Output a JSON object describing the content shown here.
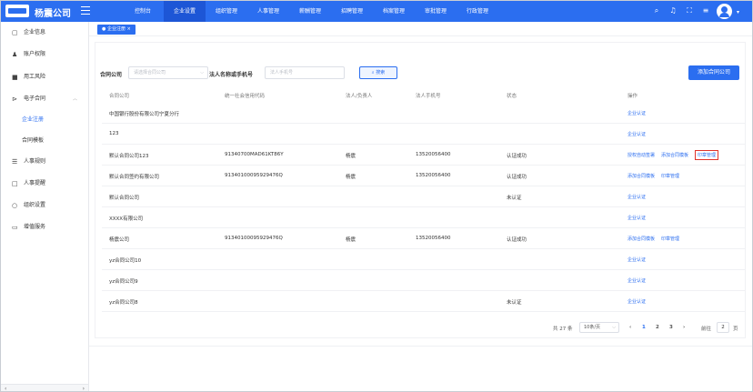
{
  "header": {
    "company": "杨震公司",
    "nav": [
      "控制台",
      "企业设置",
      "组织管理",
      "人事管理",
      "薪酬管理",
      "招聘管理",
      "档案管理",
      "审批管理",
      "行政管理"
    ],
    "active_nav": 1
  },
  "sidebar": {
    "items": [
      {
        "label": "企业信息",
        "icon": "document-icon"
      },
      {
        "label": "账户权限",
        "icon": "user-icon"
      },
      {
        "label": "用工风险",
        "icon": "shield-icon"
      },
      {
        "label": "电子合同",
        "icon": "contract-icon",
        "expanded": true
      }
    ],
    "sub_items": [
      "企业注册",
      "合同模板"
    ],
    "items_after": [
      {
        "label": "人事规则",
        "icon": "list-icon"
      },
      {
        "label": "人事提醒",
        "icon": "bell-icon"
      },
      {
        "label": "组织设置",
        "icon": "org-icon"
      },
      {
        "label": "增值服务",
        "icon": "gift-icon"
      }
    ]
  },
  "tab": {
    "label": "企业注册",
    "close": "×"
  },
  "filters": {
    "company_label": "合同公司",
    "company_placeholder": "请选择合同公司",
    "legal_label": "法人名称或手机号",
    "legal_placeholder": "法人手机号",
    "search_label": "搜索",
    "add_label": "添加合同公司"
  },
  "table": {
    "headers": [
      "合同公司",
      "统一社会信用代码",
      "法人/负责人",
      "法人手机号",
      "状态",
      "操作"
    ],
    "rows": [
      {
        "company": "中国银行股份有限公司宁夏分行",
        "code": "",
        "person": "",
        "phone": "",
        "status": "",
        "ops": [
          "企业认证"
        ]
      },
      {
        "company": "123",
        "code": "",
        "person": "",
        "phone": "",
        "status": "",
        "ops": [
          "企业认证"
        ]
      },
      {
        "company": "默认合同公司123",
        "code": "91340700MAD61KT86Y",
        "person": "杨震",
        "phone": "13520056400",
        "status": "认证成功",
        "ops": [
          "授权自动签署",
          "添加合同模板",
          "印章管理"
        ],
        "highlight": 2
      },
      {
        "company": "默认合同签约有限公司",
        "code": "91340100095929476Q",
        "person": "杨震",
        "phone": "13520056400",
        "status": "认证成功",
        "ops": [
          "添加合同模板",
          "印章管理"
        ]
      },
      {
        "company": "默认合同公司",
        "code": "",
        "person": "",
        "phone": "",
        "status": "未认证",
        "ops": [
          "企业认证"
        ]
      },
      {
        "company": "XXXX有限公司",
        "code": "",
        "person": "",
        "phone": "",
        "status": "",
        "ops": [
          "企业认证"
        ]
      },
      {
        "company": "杨震公司",
        "code": "91340100095929476Q",
        "person": "杨震",
        "phone": "13520056400",
        "status": "认证成功",
        "ops": [
          "添加合同模板",
          "印章管理"
        ]
      },
      {
        "company": "yz合同公司10",
        "code": "",
        "person": "",
        "phone": "",
        "status": "",
        "ops": [
          "企业认证"
        ]
      },
      {
        "company": "yz合同公司9",
        "code": "",
        "person": "",
        "phone": "",
        "status": "",
        "ops": [
          "企业认证"
        ]
      },
      {
        "company": "yz合同公司8",
        "code": "",
        "person": "",
        "phone": "",
        "status": "未认证",
        "ops": [
          "企业认证"
        ]
      }
    ]
  },
  "pagination": {
    "total": "共 27 条",
    "page_size": "10条/页",
    "pages": [
      "1",
      "2",
      "3"
    ],
    "current": "1",
    "goto_label": "前往",
    "goto_value": "2",
    "page_suffix": "页"
  },
  "colors": {
    "primary": "#2b6ef0",
    "highlight": "#e0332c"
  }
}
